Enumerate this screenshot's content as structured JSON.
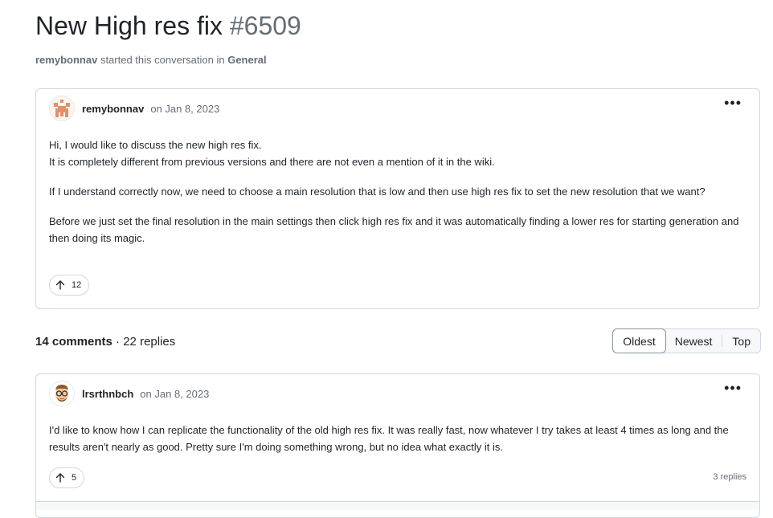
{
  "discussion": {
    "title": "New High res fix",
    "number": "#6509",
    "starter": "remybonnav",
    "started_text": "started this conversation in",
    "category": "General"
  },
  "original_post": {
    "author": "remybonnav",
    "date": "on Jan 8, 2023",
    "avatar_icon": "identicon-avatar",
    "paragraphs": [
      "Hi, I would like to discuss the new high res fix.",
      "It is completely different from previous versions and there are not even a mention of it in the wiki.",
      "If I understand correctly now, we need to choose a main resolution that is low and then use high res fix to set the new resolution that we want?",
      "Before we just set the final resolution in the main settings then click high res fix and it was automatically finding a lower res for starting generation and then doing its magic."
    ],
    "upvotes": "12"
  },
  "summary": {
    "comments": "14 comments",
    "separator": "·",
    "replies": "22 replies"
  },
  "sort": {
    "options": [
      "Oldest",
      "Newest",
      "Top"
    ],
    "selected": "Oldest"
  },
  "comments": [
    {
      "author": "lrsrthnbch",
      "date": "on Jan 8, 2023",
      "avatar_icon": "memoji-avatar",
      "text": "I'd like to know how I can replicate the functionality of the old high res fix. It was really fast, now whatever I try takes at least 4 times as long and the results aren't nearly as good. Pretty sure I'm doing something wrong, but no idea what exactly it is.",
      "upvotes": "5",
      "replies": "3 replies"
    }
  ],
  "colors": {
    "border": "#d0d7de",
    "muted": "#656d76",
    "identicon": "#e0916a"
  }
}
